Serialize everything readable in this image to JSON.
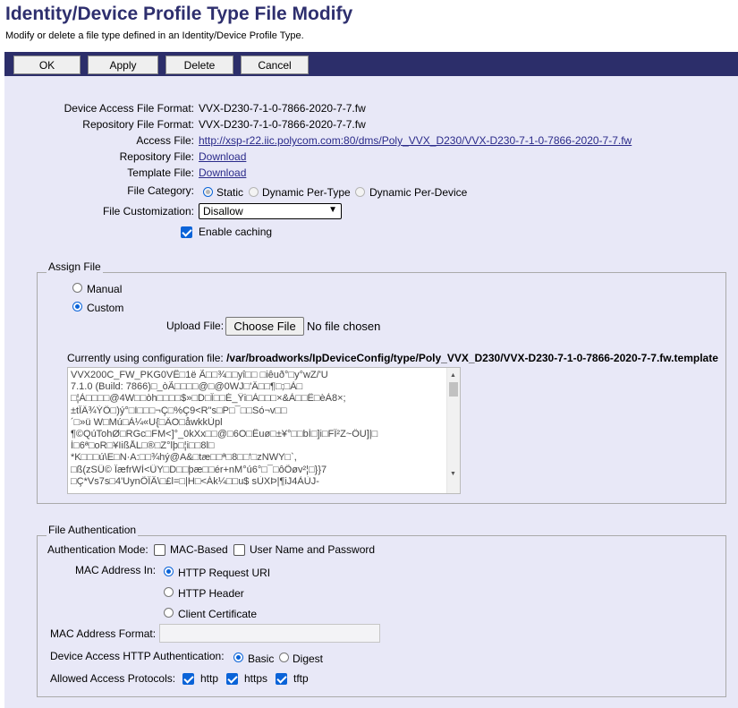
{
  "header": {
    "title": "Identity/Device Profile Type File Modify",
    "subtitle": "Modify or delete a file type defined in an Identity/Device Profile Type."
  },
  "toolbar": {
    "ok_label": "OK",
    "apply_label": "Apply",
    "delete_label": "Delete",
    "cancel_label": "Cancel"
  },
  "file_info": {
    "device_access_file_format_label": "Device Access File Format:",
    "device_access_file_format": "VVX-D230-7-1-0-7866-2020-7-7.fw",
    "repository_file_format_label": "Repository File Format:",
    "repository_file_format": "VVX-D230-7-1-0-7866-2020-7-7.fw",
    "access_file_label": "Access File:",
    "access_file": "http://xsp-r22.iic.polycom.com:80/dms/Poly_VVX_D230/VVX-D230-7-1-0-7866-2020-7-7.fw",
    "repository_file_label": "Repository File:",
    "repository_file_link": "Download",
    "template_file_label": "Template File:",
    "template_file_link": "Download",
    "file_category_label": "File Category:",
    "file_category_options": [
      "Static",
      "Dynamic Per-Type",
      "Dynamic Per-Device"
    ],
    "file_category_selected": "Static",
    "file_customization_label": "File Customization:",
    "file_customization_value": "Disallow",
    "enable_caching_label": "Enable caching",
    "enable_caching": true
  },
  "assign_file": {
    "legend": "Assign File",
    "manual_label": "Manual",
    "custom_label": "Custom",
    "selected": "Custom",
    "upload_label": "Upload File:",
    "choose_file_label": "Choose File",
    "no_file_label": "No file chosen",
    "current_config_prefix": "Currently using configuration file: ",
    "current_config_path": "/var/broadworks/IpDeviceConfig/type/Poly_VVX_D230/VVX-D230-7-1-0-7866-2020-7-7.fw.template",
    "file_content_lines": [
      "VVX200C_FW_PKG0VÊ□1ë Ã□□¾□□yî□□       □iêuð°□y°wZ/'U",
      "7.1.0 (Build: 7866)□_òÃ□□□□@□@0WJ□'Â□□¶□;□À□",
      "□¦À□□□□@4W□□òh□□□□$»□D□Î□□É_Ÿi□À□□□×&À□□Ë□èÀ8×;",
      "±tÎÄ¾ÝÖ□)ý°□I□□□¬Ç□%Ç9<R\"s□P□¯□□Só¬v□□",
      "´□»ü W□Mú□À¼«U{□ÄO□åwkkÙpl",
      "¶©QúTohØ□RGc□FM<]°_0kXx□□@□6O□Êuø□±¥°□□bÍ□]i□FÎ²Z~ÖU]|□",
      "Ì□6ª□oR□¥IißÅL□®□Z°lþ□¦i□□8l□",
      "*K□□□ú\\E□N·A:□□¾hý@A&□tæ□□ª□8□□'□zNWY□`,",
      "□ß(zSÜ© ÎæfrWÌ<ÜY□D□□þæ□□ér+nM°ú6°□¯□ôÕøv²¦□}}7",
      "□Ç*Vs7s□4'UynÕÎÂ\\□£l=□|H□<Ák¼□□u$  sÙXÞ|¶iJ4ÀÙJ-"
    ]
  },
  "file_auth": {
    "legend": "File Authentication",
    "auth_mode_label": "Authentication Mode:",
    "mac_based_label": "MAC-Based",
    "mac_based": false,
    "user_pass_label": "User Name and Password",
    "user_pass": false,
    "mac_in_label": "MAC Address In:",
    "mac_in_options": [
      "HTTP Request URI",
      "HTTP Header",
      "Client Certificate"
    ],
    "mac_in_selected": "HTTP Request URI",
    "mac_format_label": "MAC Address Format:",
    "mac_format_value": "",
    "http_auth_label": "Device Access HTTP Authentication:",
    "http_auth_options": [
      "Basic",
      "Digest"
    ],
    "http_auth_selected": "Basic",
    "protocols_label": "Allowed Access Protocols:",
    "protocols": [
      {
        "label": "http",
        "checked": true
      },
      {
        "label": "https",
        "checked": true
      },
      {
        "label": "tftp",
        "checked": true
      }
    ]
  },
  "colors": {
    "title": "#2e2f6e",
    "toolbar": "#2c2e6a",
    "panel": "#e8e8f7",
    "accent": "#0a63d8",
    "link": "#2b2b8a"
  }
}
